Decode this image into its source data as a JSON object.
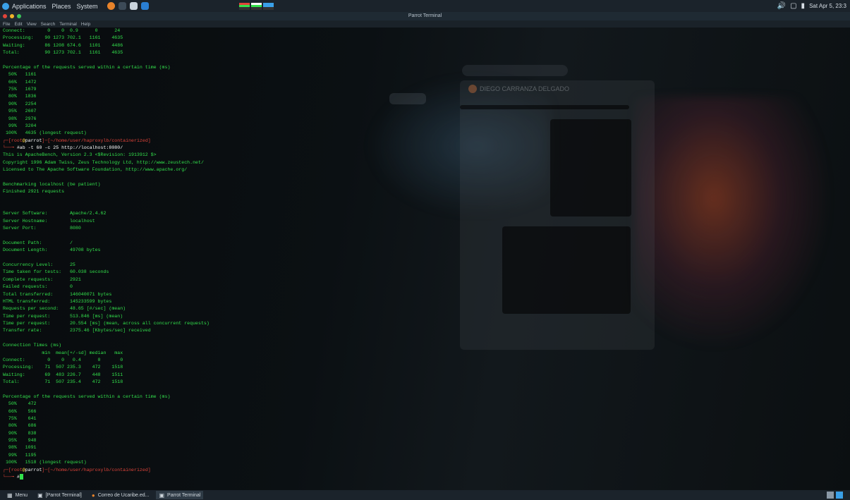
{
  "top_panel": {
    "applications": "Applications",
    "places": "Places",
    "system": "System",
    "clock": "Sat Apr 5, 23:3"
  },
  "window": {
    "title": "Parrot Terminal",
    "menu": [
      "File",
      "Edit",
      "View",
      "Search",
      "Terminal",
      "Help"
    ]
  },
  "background": {
    "ghost_window_title": "DIEGO CARRANZA DELGADO"
  },
  "terminal": {
    "lines_a": [
      "Connect:        0    0  0.9      0      24",
      "Processing:    90 1273 702.1   1161    4635",
      "Waiting:       86 1208 674.6   1101    4486",
      "Total:         90 1273 702.1   1161    4635",
      "",
      "Percentage of the requests served within a certain time (ms)",
      "  50%   1161",
      "  66%   1472",
      "  75%   1679",
      "  80%   1836",
      "  90%   2254",
      "  95%   2607",
      "  98%   2976",
      "  99%   3204",
      " 100%   4635 (longest request)"
    ],
    "prompt1": {
      "open": "┌─[",
      "user": "root",
      "at": "@",
      "host": "parrot",
      "close": "]─[",
      "path": "~/home/user/haproxylb/containerized",
      "end": "]",
      "arrow": "└──╼ ",
      "command": "#ab -t 60 -c 25 http://localhost:8080/"
    },
    "lines_b": [
      "This is ApacheBench, Version 2.3 <$Revision: 1913912 $>",
      "Copyright 1996 Adam Twiss, Zeus Technology Ltd, http://www.zeustech.net/",
      "Licensed to The Apache Software Foundation, http://www.apache.org/",
      "",
      "Benchmarking localhost (be patient)",
      "Finished 2921 requests",
      "",
      "",
      "Server Software:        Apache/2.4.62",
      "Server Hostname:        localhost",
      "Server Port:            8080",
      "",
      "Document Path:          /",
      "Document Length:        49708 bytes",
      "",
      "Concurrency Level:      25",
      "Time taken for tests:   60.038 seconds",
      "Complete requests:      2921",
      "Failed requests:        0",
      "Total transferred:      146040071 bytes",
      "HTML transferred:       145233599 bytes",
      "Requests per second:    48.65 [#/sec] (mean)",
      "Time per request:       513.846 [ms] (mean)",
      "Time per request:       20.554 [ms] (mean, across all concurrent requests)",
      "Transfer rate:          2375.46 [Kbytes/sec] received",
      "",
      "Connection Times (ms)",
      "              min  mean[+/-sd] median   max",
      "Connect:        0    0   0.4      0       0",
      "Processing:    71  507 235.3    472    1518",
      "Waiting:       69  483 226.7    448    1511",
      "Total:         71  507 235.4    472    1518",
      "",
      "Percentage of the requests served within a certain time (ms)",
      "  50%    472",
      "  66%    566",
      "  75%    641",
      "  80%    686",
      "  90%    838",
      "  95%    948",
      "  98%   1091",
      "  99%   1195",
      " 100%   1518 (longest request)"
    ],
    "prompt2": {
      "open": "┌─[",
      "user": "root",
      "at": "@",
      "host": "parrot",
      "close": "]─[",
      "path": "~/home/user/haproxylb/containerized",
      "end": "]",
      "arrow": "└──╼ ",
      "command": "#"
    }
  },
  "taskbar": {
    "menu": "Menu",
    "items": [
      "[Parrot Terminal]",
      "Correo de Ucaribe.ed...",
      "Parrot Terminal"
    ]
  },
  "colors": {
    "terminal_green": "#33e14c",
    "prompt_red": "#e0443a",
    "panel_bg": "#1b232b"
  }
}
